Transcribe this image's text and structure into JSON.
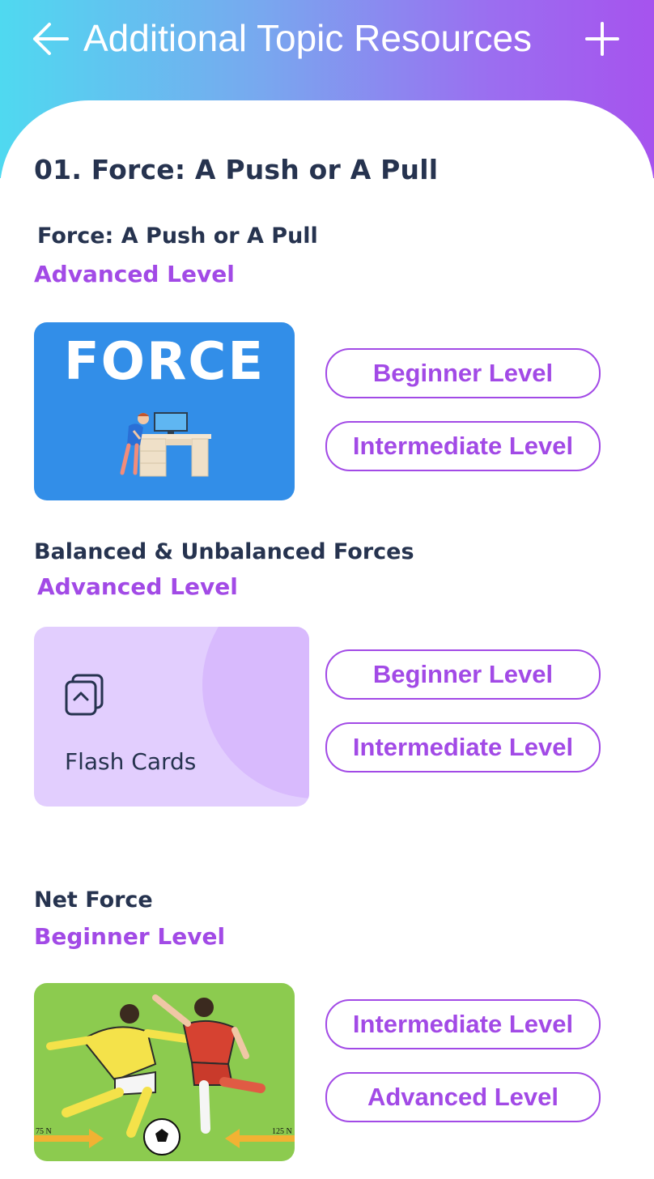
{
  "header": {
    "title": "Additional Topic Resources",
    "back_icon": "arrow-left-icon",
    "add_icon": "plus-icon",
    "gradient": [
      "#4fd9f0",
      "#a653ee"
    ]
  },
  "topic": {
    "title": "01. Force: A Push or A Pull"
  },
  "sections": [
    {
      "title": "Force: A Push or A Pull",
      "level": "Advanced Level",
      "card": {
        "type": "image",
        "text": "FORCE",
        "color": "#328ee8"
      },
      "buttons": [
        "Beginner Level",
        "Intermediate Level"
      ]
    },
    {
      "title": "Balanced & Unbalanced Forces",
      "level": "Advanced Level",
      "card": {
        "type": "flash-cards",
        "label": "Flash Cards",
        "icon": "flash-cards-icon",
        "color": "#e2cefe"
      },
      "buttons": [
        "Beginner Level",
        "Intermediate Level"
      ]
    },
    {
      "title": "Net Force",
      "level": "Beginner Level",
      "card": {
        "type": "image",
        "left_force": "75 N",
        "right_force": "125 N",
        "color": "#8ccb4f"
      },
      "buttons": [
        "Intermediate Level",
        "Advanced Level"
      ]
    }
  ],
  "colors": {
    "accent": "#a24ae6",
    "text": "#26334f"
  }
}
